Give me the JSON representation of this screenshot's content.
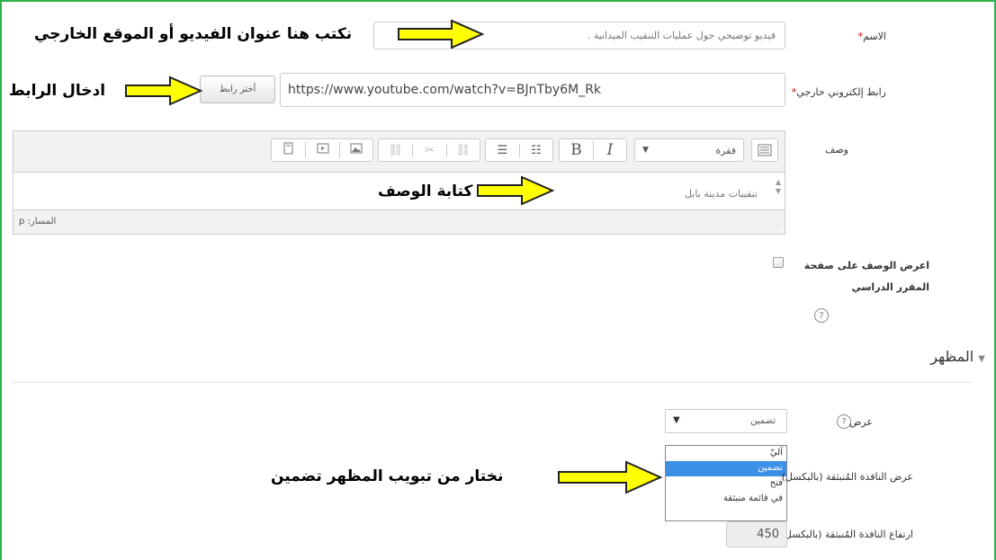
{
  "form": {
    "name_label": "الاسم",
    "name_value": "فيديو توضيحي حول عمليات التنقيب الميدانية .",
    "url_label": "رابط إلكتروني خارجي",
    "url_value": "https://www.youtube.com/watch?v=BJnTby6M_Rk",
    "choose_link": "أختر رابط",
    "desc_label": "وصف",
    "format_select": "فقرة",
    "editor_text": "تنقيبات مدينة بابل",
    "path_label": "المسار: p",
    "show_desc_label_1": "اعرض الوصف على صفحة",
    "show_desc_label_2": "المقرر الدراسي",
    "required_mark": "*"
  },
  "appearance": {
    "section_title": "المظهر",
    "display_label": "عرض",
    "display_value": "تضمين",
    "options": [
      "آليّ",
      "تضمين",
      "فتح",
      "في قائمة منبثقة"
    ],
    "selected_index": 1,
    "popup_width_label": "عرض النافذة المُنبثقة (بالبكسل)",
    "popup_height_label": "ارتفاع النافذة المُنبثقة (بالبكسل)",
    "popup_height_value": "450"
  },
  "annotations": {
    "title_note": "نكتب هنا عنوان الفيديو أو الموقع الخارجي",
    "link_note": "ادخال الرابط",
    "desc_note": "كتابة الوصف",
    "display_note": "نختار من تبويب المظهر تضمين"
  },
  "colors": {
    "frame": "#2eb24a",
    "arrow_fill": "#ffff00",
    "selection": "#3b8fe5",
    "required": "#cc0000"
  }
}
